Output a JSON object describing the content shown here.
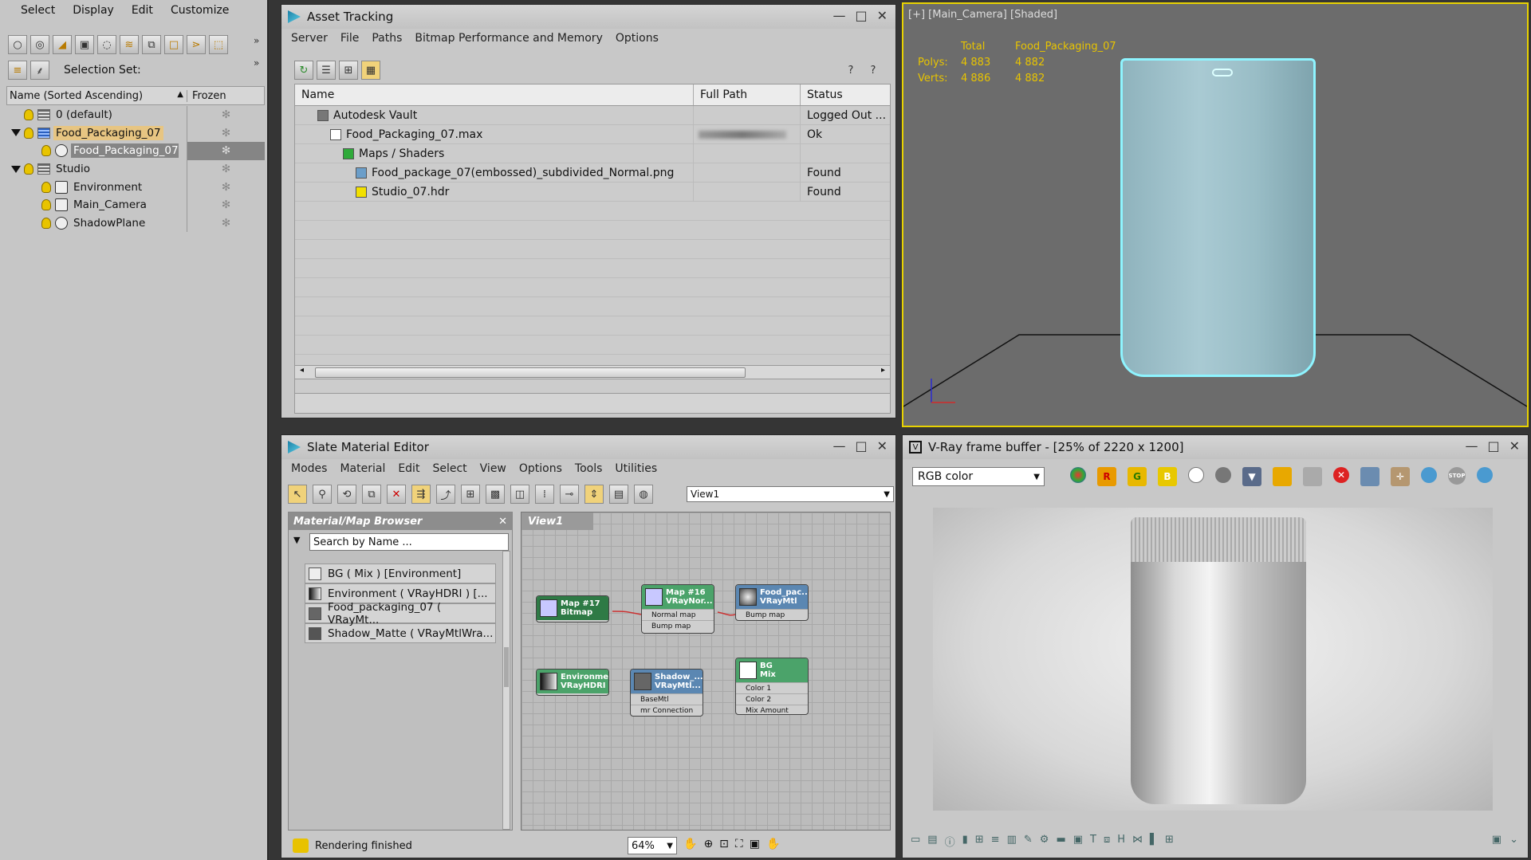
{
  "scene_explorer": {
    "menu": [
      "Select",
      "Display",
      "Edit",
      "Customize"
    ],
    "selection_set_label": "Selection Set:",
    "col_name": "Name (Sorted Ascending)",
    "col_frozen": "Frozen",
    "rows": [
      "0 (default)",
      "Food_Packaging_07",
      "Food_Packaging_07",
      "Studio",
      "Environment",
      "Main_Camera",
      "ShadowPlane"
    ]
  },
  "asset": {
    "title": "Asset Tracking",
    "menu": [
      "Server",
      "File",
      "Paths",
      "Bitmap Performance and Memory",
      "Options"
    ],
    "col_name": "Name",
    "col_path": "Full Path",
    "col_status": "Status",
    "rows": [
      {
        "name": "Autodesk Vault",
        "status": "Logged Out ..."
      },
      {
        "name": "Food_Packaging_07.max",
        "status": "Ok"
      },
      {
        "name": "Maps / Shaders",
        "status": ""
      },
      {
        "name": "Food_package_07(embossed)_subdivided_Normal.png",
        "status": "Found"
      },
      {
        "name": "Studio_07.hdr",
        "status": "Found"
      }
    ]
  },
  "viewport": {
    "label": "[+] [Main_Camera] [Shaded]",
    "total": "Total",
    "object": "Food_Packaging_07",
    "polys_label": "Polys:",
    "polys_total": "4 883",
    "polys_obj": "4 882",
    "verts_label": "Verts:",
    "verts_total": "4 886",
    "verts_obj": "4 882"
  },
  "slate": {
    "title": "Slate Material Editor",
    "menu": [
      "Modes",
      "Material",
      "Edit",
      "Select",
      "View",
      "Options",
      "Tools",
      "Utilities"
    ],
    "view_select": "View1",
    "browser_title": "Material/Map Browser",
    "search_placeholder": "Search by Name ...",
    "browser_items": [
      "BG ( Mix ) [Environment]",
      "Environment ( VRayHDRI ) [...",
      "Food_packaging_07 ( VRayMt...",
      "Shadow_Matte ( VRayMtlWra..."
    ],
    "view_tab": "View1",
    "nodes": {
      "map17_a": "Map #17",
      "map17_b": "Bitmap",
      "map16_a": "Map #16",
      "map16_b": "VRayNor...",
      "map16_s1": "Normal map",
      "map16_s2": "Bump map",
      "food_a": "Food_pac...",
      "food_b": "VRayMtl",
      "food_s1": "Bump map",
      "env_a": "Environment",
      "env_b": "VRayHDRI",
      "shadow_a": "Shadow_...",
      "shadow_b": "VRayMtl...",
      "shadow_s1": "BaseMtl",
      "shadow_s2": "mr Connection",
      "bg_a": "BG",
      "bg_b": "Mix",
      "bg_s1": "Color 1",
      "bg_s2": "Color 2",
      "bg_s3": "Mix Amount"
    },
    "status": "Rendering finished",
    "zoom": "64%"
  },
  "vray": {
    "title": "V-Ray frame buffer - [25% of 2220 x 1200]",
    "channel": "RGB color",
    "r": "R",
    "g": "G",
    "b": "B"
  }
}
